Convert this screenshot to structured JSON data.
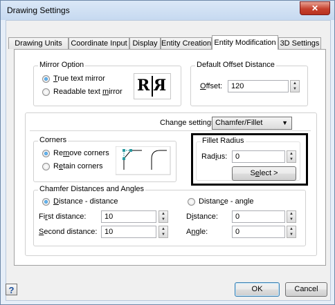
{
  "window": {
    "title": "Drawing Settings",
    "close_glyph": "✕"
  },
  "tabs": [
    {
      "label": "Drawing Units"
    },
    {
      "label": "Coordinate Input"
    },
    {
      "label": "Display"
    },
    {
      "label": "Entity Creation"
    },
    {
      "label": "Entity Modification"
    },
    {
      "label": "3D Settings"
    }
  ],
  "active_tab": "Entity Modification",
  "mirror": {
    "group_label": "Mirror Option",
    "true_text_prefix": "",
    "true_text_key": "T",
    "true_text_rest": "rue text mirror",
    "readable_prefix": "Readable text ",
    "readable_key": "m",
    "readable_rest": "irror",
    "selected": "true",
    "preview_left": "R",
    "preview_right": "R"
  },
  "offset": {
    "group_label": "Default Offset Distance",
    "label_key": "O",
    "label_rest": "ffset:",
    "value": "120"
  },
  "change_settings": {
    "label_prefix": "Chan",
    "label_key": "g",
    "label_rest": "e settings for:",
    "selected": "Chamfer/Fillet"
  },
  "corners": {
    "group_label": "Corners",
    "remove_prefix": "Re",
    "remove_key": "m",
    "remove_rest": "ove corners",
    "retain_prefix": "R",
    "retain_key": "e",
    "retain_rest": "tain corners",
    "selected": "remove"
  },
  "fillet": {
    "group_label": "Fillet Radius",
    "radius_prefix": "Rad",
    "radius_key": "i",
    "radius_rest": "us:",
    "radius_value": "0",
    "select_prefix": "S",
    "select_key": "e",
    "select_rest": "lect >"
  },
  "chamfer": {
    "group_label": "Chamfer Distances and Angles",
    "dd_prefix": "",
    "dd_key": "D",
    "dd_rest": "istance - distance",
    "da_prefix": "Distan",
    "da_key": "c",
    "da_rest": "e - angle",
    "selected": "distance-distance",
    "first_prefix": "Fi",
    "first_key": "r",
    "first_rest": "st distance:",
    "first_value": "10",
    "second_prefix": "",
    "second_key": "S",
    "second_rest": "econd distance:",
    "second_value": "10",
    "distance_prefix": "D",
    "distance_key": "i",
    "distance_rest": "stance:",
    "distance_value": "0",
    "angle_prefix": "A",
    "angle_key": "n",
    "angle_rest": "gle:",
    "angle_value": "0"
  },
  "footer": {
    "help_glyph": "?",
    "ok_label": "OK",
    "cancel_label": "Cancel"
  },
  "colors": {
    "accent": "#3c7fb1",
    "title_gradient": "#c6d9f0",
    "close_red": "#c6412e",
    "preview_line": "#2b9aa0"
  }
}
